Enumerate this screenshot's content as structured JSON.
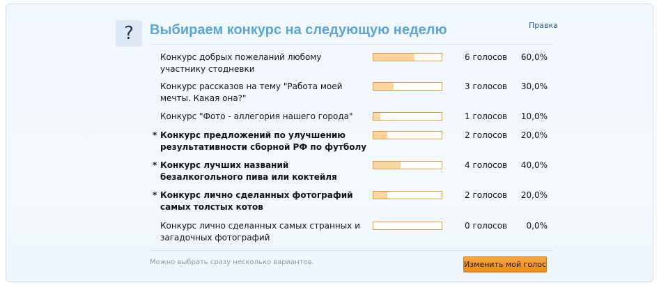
{
  "poll": {
    "icon_glyph": "?",
    "title": "Выбираем конкурс на следующую неделю",
    "edit_link": "Правка",
    "options": [
      {
        "text": "Конкурс добрых пожеланий любому участнику стодневки",
        "votes": "6 голосов",
        "percent": "60,0%",
        "fraction": 0.6,
        "bold": false,
        "mark": ""
      },
      {
        "text": "Конкурс рассказов на тему \"Работа моей мечты. Какая она?\"",
        "votes": "3 голосов",
        "percent": "30,0%",
        "fraction": 0.3,
        "bold": false,
        "mark": ""
      },
      {
        "text": "Конкурс \"Фото - аллегория нашего города\"",
        "votes": "1 голосов",
        "percent": "10,0%",
        "fraction": 0.1,
        "bold": false,
        "mark": ""
      },
      {
        "text": "Конкурс предложений по улучшению результативности сборной РФ по футболу",
        "votes": "2 голосов",
        "percent": "20,0%",
        "fraction": 0.2,
        "bold": true,
        "mark": "*"
      },
      {
        "text": "Конкурс лучших названий безалкогольного пива или коктейля",
        "votes": "4 голосов",
        "percent": "40,0%",
        "fraction": 0.4,
        "bold": true,
        "mark": "*"
      },
      {
        "text": "Конкурс лично сделанных фотографий самых толстых котов",
        "votes": "2 голосов",
        "percent": "20,0%",
        "fraction": 0.2,
        "bold": true,
        "mark": "*"
      },
      {
        "text": "Конкурс лично сделанных самых странных и загадочных фотографий",
        "votes": "0 голосов",
        "percent": "0,0%",
        "fraction": 0.0,
        "bold": false,
        "mark": ""
      }
    ],
    "hint": "Можно выбрать сразу несколько вариантов.",
    "change_vote_label": "Изменить мой голос",
    "colors": {
      "title": "#5aa6d6",
      "bar_border": "#e39a35",
      "bar_fill": "#fbd6a3",
      "button": "#f39a2c"
    }
  }
}
